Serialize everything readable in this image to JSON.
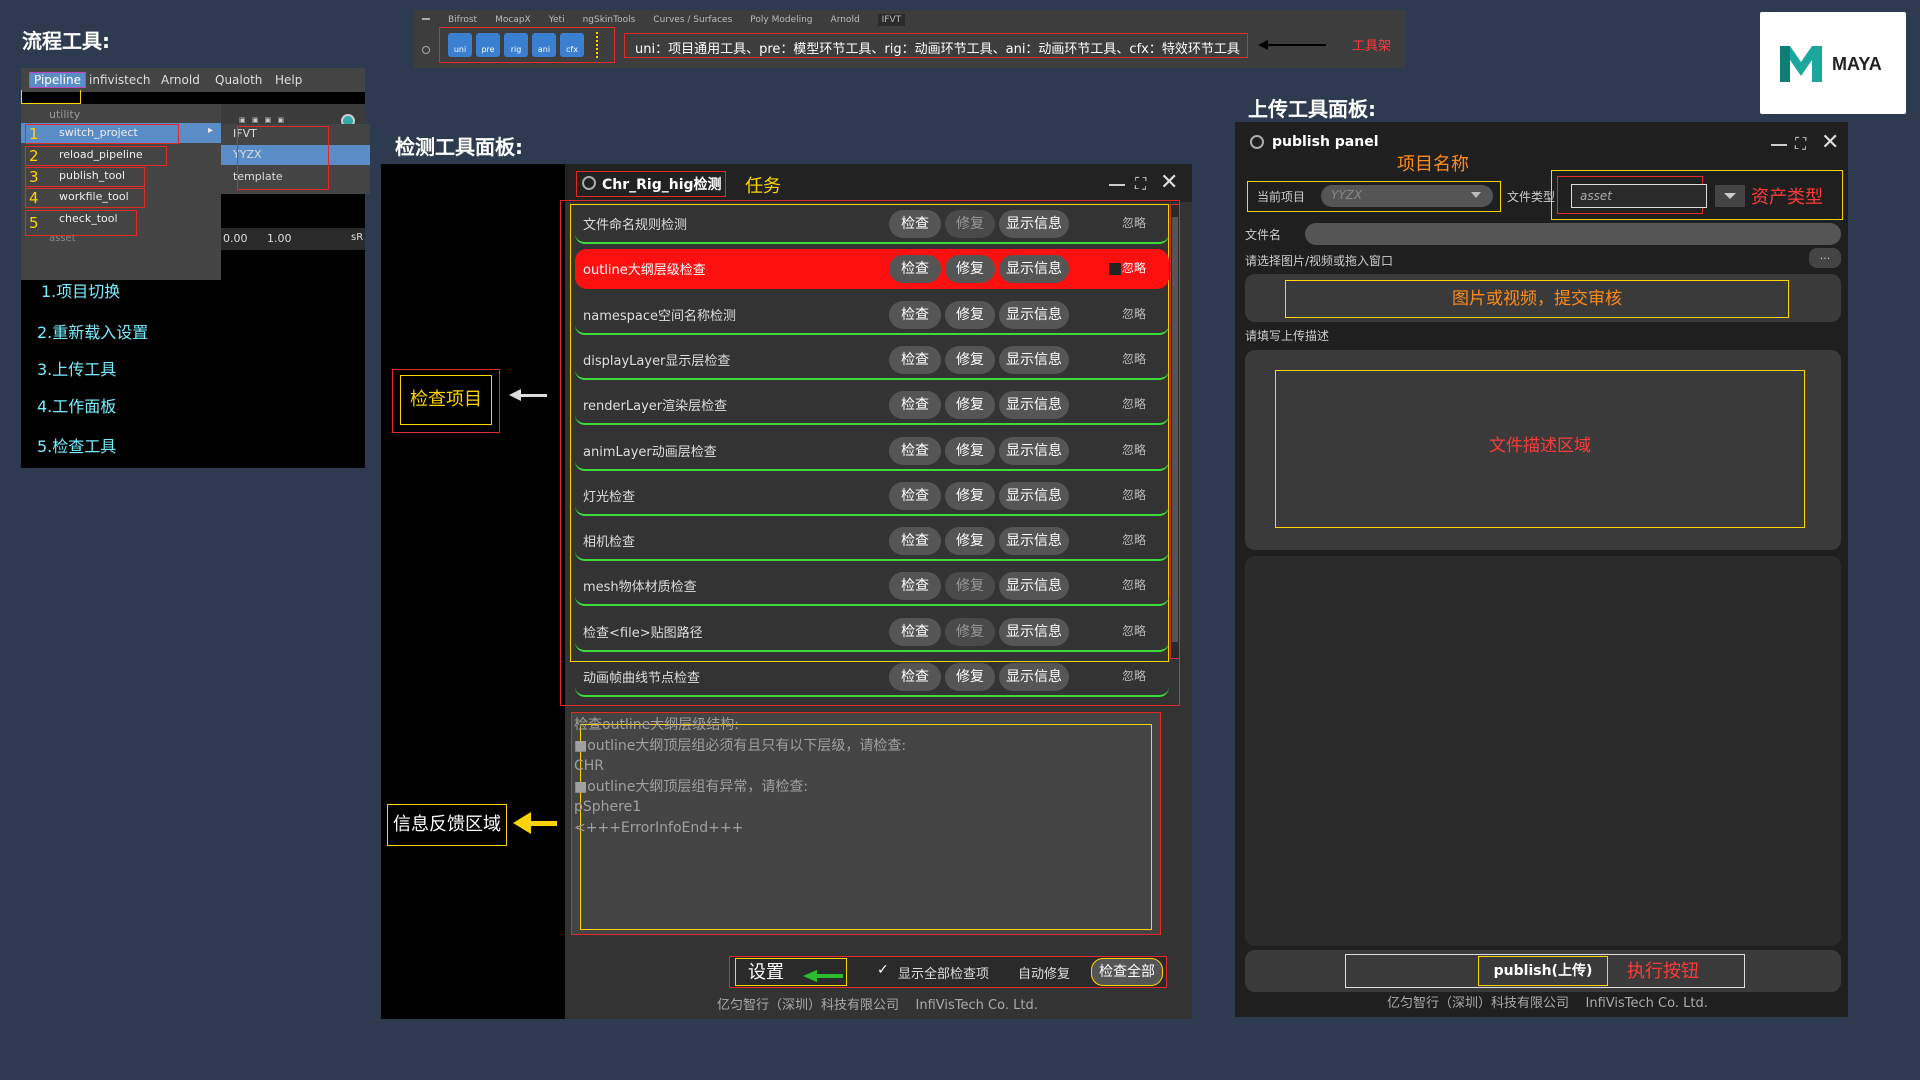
{
  "section_titles": {
    "flow": "流程工具:",
    "check": "检测工具面板:",
    "upload": "上传工具面板:"
  },
  "pipeline": {
    "menubar": [
      "Pipeline",
      "infivistech",
      "Arnold",
      "Qualoth",
      "Help"
    ],
    "group": "utility",
    "items": [
      {
        "num": "1",
        "label": "switch_project"
      },
      {
        "num": "2",
        "label": "reload_pipeline"
      },
      {
        "num": "3",
        "label": "publish_tool"
      },
      {
        "num": "4",
        "label": "workfile_tool"
      },
      {
        "num": "5",
        "label": "check_tool"
      }
    ],
    "under": "asset",
    "submenu": [
      "IFVT",
      "YYZX",
      "template"
    ],
    "toolbar_values": [
      "0.00",
      "1.00",
      "sR"
    ],
    "steps": [
      "1.项目切换",
      "2.重新载入设置",
      "3.上传工具",
      "4.工作面板",
      "5.检查工具"
    ]
  },
  "shelf": {
    "tabs": [
      "Bifrost",
      "MocapX",
      "Yeti",
      "ngSkinTools",
      "Curves / Surfaces",
      "Poly Modeling",
      "Arnold",
      "IFVT"
    ],
    "icons": [
      "uni",
      "pre",
      "rig",
      "ani",
      "cfx"
    ],
    "description": "uni：项目通用工具、pre：模型环节工具、rig：动画环节工具、ani：动画环节工具、cfx：特效环节工具",
    "annotation": "工具架"
  },
  "logo": {
    "text": "MAYA"
  },
  "check_panel": {
    "title": "Chr_Rig_hig检测",
    "task_label": "任务",
    "btn_check": "检查",
    "btn_fix": "修复",
    "btn_info": "显示信息",
    "ignore": "忽略",
    "rows": [
      {
        "name": "文件命名规则检测",
        "status": "ok",
        "fix_enabled": false
      },
      {
        "name": "outline大纲层级检查",
        "status": "fail",
        "fix_enabled": true
      },
      {
        "name": "namespace空间名称检测",
        "status": "ok",
        "fix_enabled": true
      },
      {
        "name": "displayLayer显示层检查",
        "status": "ok",
        "fix_enabled": true
      },
      {
        "name": "renderLayer渲染层检查",
        "status": "ok",
        "fix_enabled": true
      },
      {
        "name": "animLayer动画层检查",
        "status": "ok",
        "fix_enabled": true
      },
      {
        "name": "灯光检查",
        "status": "ok",
        "fix_enabled": true
      },
      {
        "name": "相机检查",
        "status": "ok",
        "fix_enabled": true
      },
      {
        "name": "mesh物体材质检查",
        "status": "ok",
        "fix_enabled": false
      },
      {
        "name": "检查<file>贴图路径",
        "status": "ok",
        "fix_enabled": false
      },
      {
        "name": "动画帧曲线节点检查",
        "status": "ok",
        "fix_enabled": true
      }
    ],
    "feedback": [
      "检查outline大纲层级结构:",
      "■outline大纲顶层组必须有且只有以下层级，请检查:",
      "CHR",
      "■outline大纲顶层组有异常，请检查:",
      "pSphere1",
      "<+++ErrorInfoEnd+++"
    ],
    "settings_label": "设置",
    "show_all": "显示全部检查项",
    "auto_fix": "自动修复",
    "check_all": "检查全部",
    "footer": "亿匀智行（深圳）科技有限公司    InfiVisTech Co. Ltd.",
    "annotation_items": "检查项目",
    "annotation_feedback": "信息反馈区域"
  },
  "upload_panel": {
    "title": "publish panel",
    "project_name_tag": "项目名称",
    "current_project_label": "当前项目",
    "current_project_value": "YYZX",
    "file_type_label": "文件类型",
    "file_type_value": "asset",
    "asset_type_tag": "资产类型",
    "filename_label": "文件名",
    "media_label": "请选择图片/视频或拖入窗口",
    "browse": "...",
    "media_drop": "图片或视频，提交审核",
    "desc_label": "请填写上传描述",
    "desc_area": "文件描述区域",
    "publish_btn": "publish(上传)",
    "exec_tag": "执行按钮",
    "footer": "亿匀智行（深圳）科技有限公司    InfiVisTech Co. Ltd."
  }
}
